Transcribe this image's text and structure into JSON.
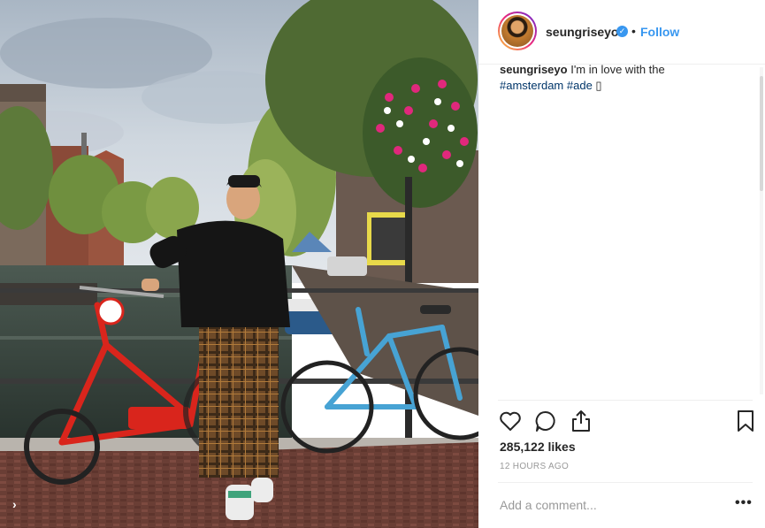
{
  "post": {
    "username": "seungriseyo",
    "follow_label": "Follow",
    "separator": "•",
    "caption": {
      "username": "seungriseyo",
      "text": " I'm in love with the",
      "hashtag_1": "#amsterdam",
      "hashtag_2": "#ade",
      "emoji": "▯"
    },
    "likes": "285,122 likes",
    "timestamp": "12 HOURS AGO",
    "comment_placeholder": "Add a comment...",
    "more_label": "•••"
  },
  "icons": {
    "verified": "verified-badge-icon",
    "like": "heart-icon",
    "comment": "speech-bubble-icon",
    "share": "share-icon",
    "save": "bookmark-icon",
    "nav": "chevron-right-icon"
  },
  "colors": {
    "link": "#3897f0",
    "hashtag": "#003569",
    "text": "#262626",
    "muted": "#999999",
    "divider": "#efefef",
    "red_bike": "#d9251c",
    "blue_bike": "#47a3d4",
    "flowers": "#e0287c"
  }
}
